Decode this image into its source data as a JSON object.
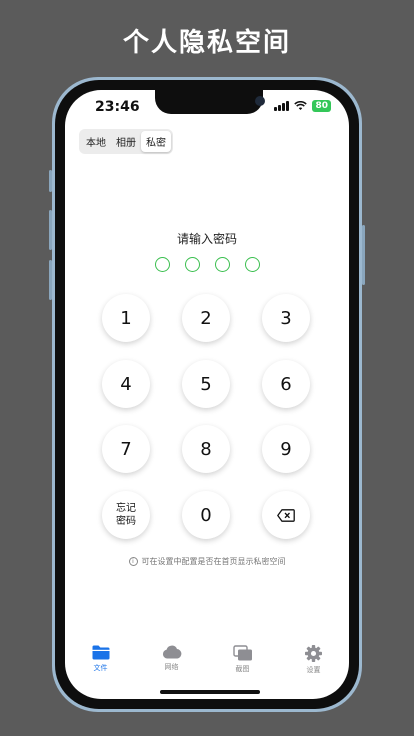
{
  "headline": "个人隐私空间",
  "status_bar": {
    "time": "23:46",
    "battery": "80",
    "colors": {
      "battery": "#34c759"
    }
  },
  "segment": {
    "tabs": [
      "本地",
      "相册",
      "私密"
    ],
    "selected": "私密"
  },
  "passcode": {
    "prompt": "请输入密码",
    "digits_total": 4,
    "digits_entered": 0,
    "color": "#3bbf4f"
  },
  "keypad": {
    "keys": [
      "1",
      "2",
      "3",
      "4",
      "5",
      "6",
      "7",
      "8",
      "9",
      "忘记\n密码",
      "0",
      "backspace-icon"
    ],
    "forgot_line1": "忘记",
    "forgot_line2": "密码"
  },
  "info": {
    "icon": "info-icon",
    "text": "可在设置中配置是否在首页显示私密空间"
  },
  "tabbar": {
    "items": [
      {
        "label": "文件",
        "icon": "folder-icon",
        "active": true
      },
      {
        "label": "网络",
        "icon": "cloud-icon",
        "active": false
      },
      {
        "label": "截图",
        "icon": "screenshot-icon",
        "active": false
      },
      {
        "label": "设置",
        "icon": "gear-icon",
        "active": false
      }
    ],
    "active_color": "#1a73e8"
  }
}
